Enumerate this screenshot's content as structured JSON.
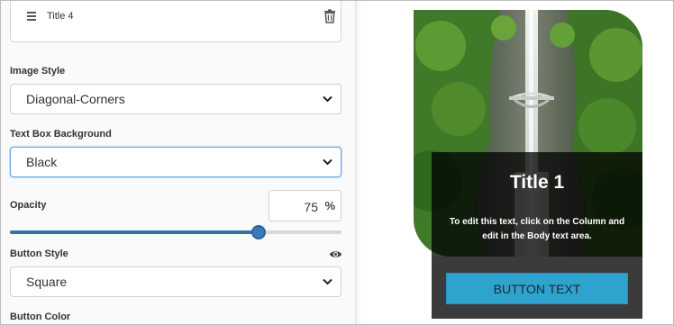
{
  "list_item": {
    "title": "Title 4",
    "drag_icon": "hamburger-icon",
    "delete_icon": "trash-icon"
  },
  "image_style": {
    "label": "Image Style",
    "value": "Diagonal-Corners"
  },
  "text_box_background": {
    "label": "Text Box Background",
    "value": "Black"
  },
  "opacity": {
    "label": "Opacity",
    "value": "75",
    "unit_icon": "percent-icon",
    "slider_level": 0.75
  },
  "button_style": {
    "label": "Button Style",
    "value": "Square",
    "visibility_icon": "eye-icon"
  },
  "button_color": {
    "label": "Button Color"
  },
  "preview": {
    "title": "Title 1",
    "body": "To edit this text, click on the Column and edit in the Body text area.",
    "button_text": "BUTTON TEXT"
  },
  "colors": {
    "accent": "#3470a6",
    "focus_border": "#6aa7dc",
    "preview_button": "#2ea3cd",
    "button_area": "#3b3b3b",
    "text_box_bg": "rgba(0,0,0,0.75)"
  }
}
